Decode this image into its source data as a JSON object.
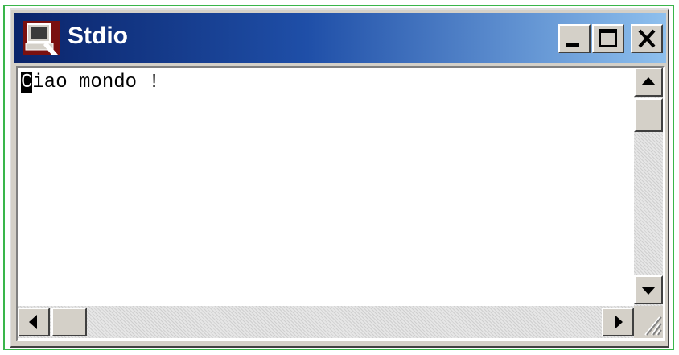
{
  "window": {
    "title": "Stdio",
    "app_icon": "console-app-icon"
  },
  "titlebar_buttons": {
    "minimize_icon": "minimize-icon",
    "maximize_icon": "maximize-icon",
    "close_icon": "close-icon"
  },
  "console": {
    "cursor_char": "C",
    "text_rest": "iao mondo !"
  },
  "scrollbars": {
    "up_icon": "arrow-up-icon",
    "down_icon": "arrow-down-icon",
    "left_icon": "arrow-left-icon",
    "right_icon": "arrow-right-icon"
  },
  "colors": {
    "title_gradient_start": "#0a246a",
    "title_gradient_end": "#8ec0ee",
    "outer_frame": "#39b54a",
    "window_face": "#d4d0c8"
  }
}
